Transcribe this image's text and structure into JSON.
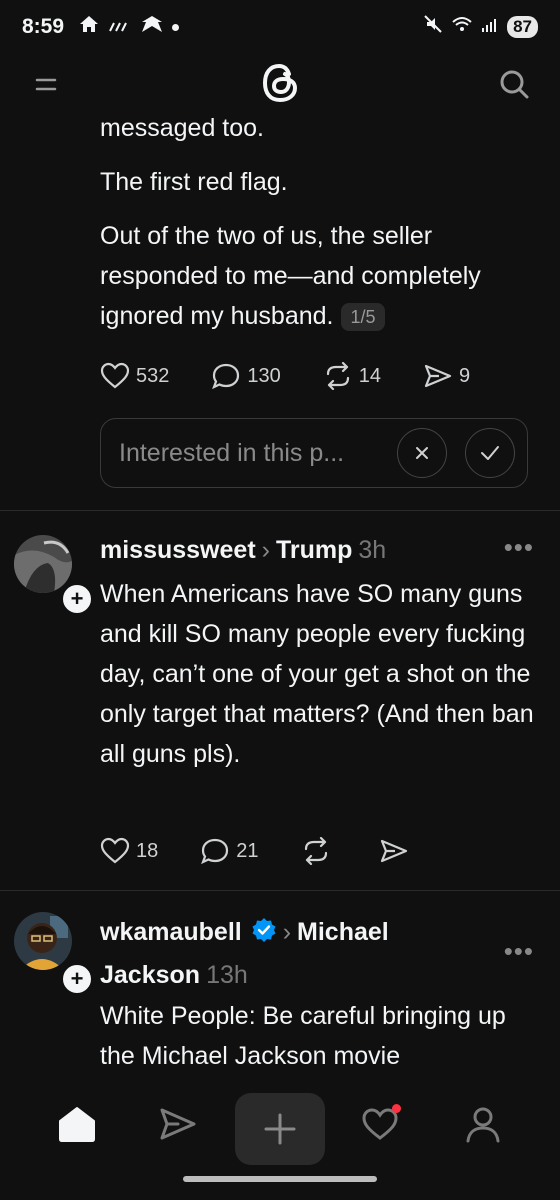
{
  "status_bar": {
    "time": "8:59",
    "battery": "87"
  },
  "post1": {
    "text_lines": [
      "messaged too.",
      "The first red flag.",
      "Out of the two of us, the seller responded to me—and completely ignored my husband."
    ],
    "pager": "1/5",
    "likes": "532",
    "replies": "130",
    "reposts": "14",
    "shares": "9",
    "suggest_placeholder": "Interested in this p..."
  },
  "post2": {
    "username": "missussweet",
    "topic": "Trump",
    "age": "3h",
    "text": "When Americans have SO many guns and kill SO many people every fucking day, can’t one of your get a shot on the only target that matters? (And then ban all guns pls).",
    "likes": "18",
    "replies": "21"
  },
  "post3": {
    "username": "wkamaubell",
    "topic_line1": "Michael",
    "topic_line2": "Jackson",
    "age": "13h",
    "text": "White People: Be careful bringing up the Michael Jackson movie",
    "verified": true
  },
  "colors": {
    "background": "#101010",
    "text": "#f3f5f7",
    "muted": "#777777",
    "verified_blue": "#0095f6",
    "notification_red": "#ff3040"
  }
}
